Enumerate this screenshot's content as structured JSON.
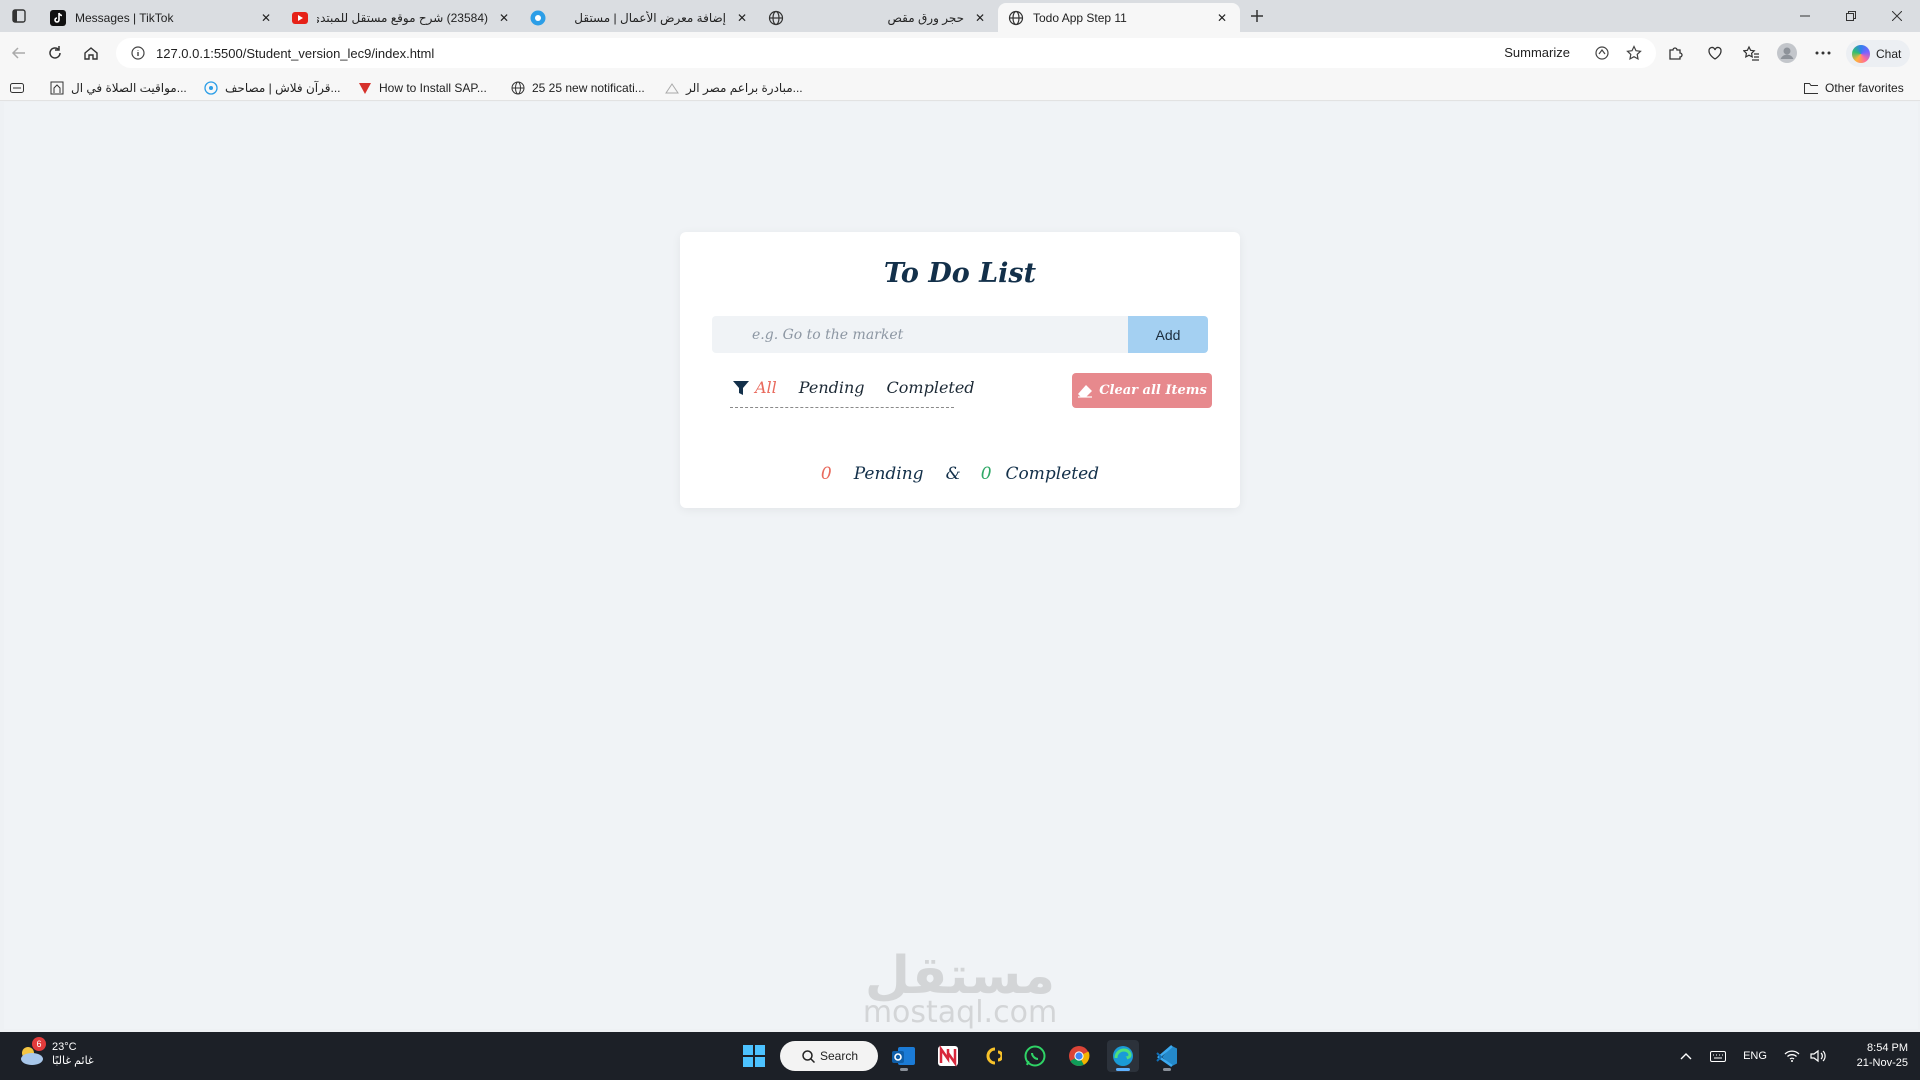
{
  "browser": {
    "tabs": [
      {
        "title": "Messages | TikTok",
        "favicon": "tiktok-icon",
        "rtl": false
      },
      {
        "title": "(23584) شرح موقع مستقل للمبتدئ",
        "favicon": "youtube-icon",
        "rtl": true
      },
      {
        "title": "إضافة معرض الأعمال | مستقل",
        "favicon": "mostaql-icon",
        "rtl": true
      },
      {
        "title": "حجر ورق مقص",
        "favicon": "globe-icon",
        "rtl": true
      },
      {
        "title": "Todo App Step 11",
        "favicon": "globe-icon",
        "rtl": false,
        "active": true
      }
    ],
    "address": {
      "url": "127.0.0.1:5500/Student_version_lec9/index.html",
      "summarize_label": "Summarize"
    },
    "chat_label": "Chat",
    "favorites": [
      {
        "label": "مواقيت الصلاة في ال...",
        "icon": "mosque-icon"
      },
      {
        "label": "قرآن فلاش | مصاحف...",
        "icon": "quran-icon"
      },
      {
        "label": "How to Install SAP...",
        "icon": "sap-icon"
      },
      {
        "label": "25 25 new notificati...",
        "icon": "globe-icon"
      },
      {
        "label": "مبادرة براعم مصر الر...",
        "icon": "initiative-icon"
      }
    ],
    "other_favorites_label": "Other favorites"
  },
  "app": {
    "title": "To Do List",
    "input_placeholder": "e.g. Go to the market",
    "add_label": "Add",
    "filters": [
      {
        "label": "All",
        "active": true
      },
      {
        "label": "Pending",
        "active": false
      },
      {
        "label": "Completed",
        "active": false
      }
    ],
    "clear_label": "Clear all Items",
    "counts": {
      "pending_count": "0",
      "pending_label": "Pending",
      "separator": "&",
      "completed_count": "0",
      "completed_label": "Completed"
    },
    "colors": {
      "accent_red": "#e96a5d",
      "accent_green": "#2fa866",
      "add_button": "#a4d0f2",
      "clear_button": "#e7898d",
      "title": "#13304a"
    }
  },
  "watermark": {
    "line1": "مستقل",
    "line2": "mostaql.com"
  },
  "taskbar": {
    "weather": {
      "temp": "23°C",
      "condition": "غائم غالبًا",
      "badge": "6"
    },
    "search_label": "Search",
    "apps": [
      "start-icon",
      "search",
      "outlook-icon",
      "news-icon",
      "clipchamp-icon",
      "whatsapp-icon",
      "chrome-icon",
      "edge-icon",
      "vscode-icon"
    ],
    "tray": {
      "language": "ENG"
    },
    "clock": {
      "time": "8:54 PM",
      "date": "21-Nov-25"
    }
  }
}
